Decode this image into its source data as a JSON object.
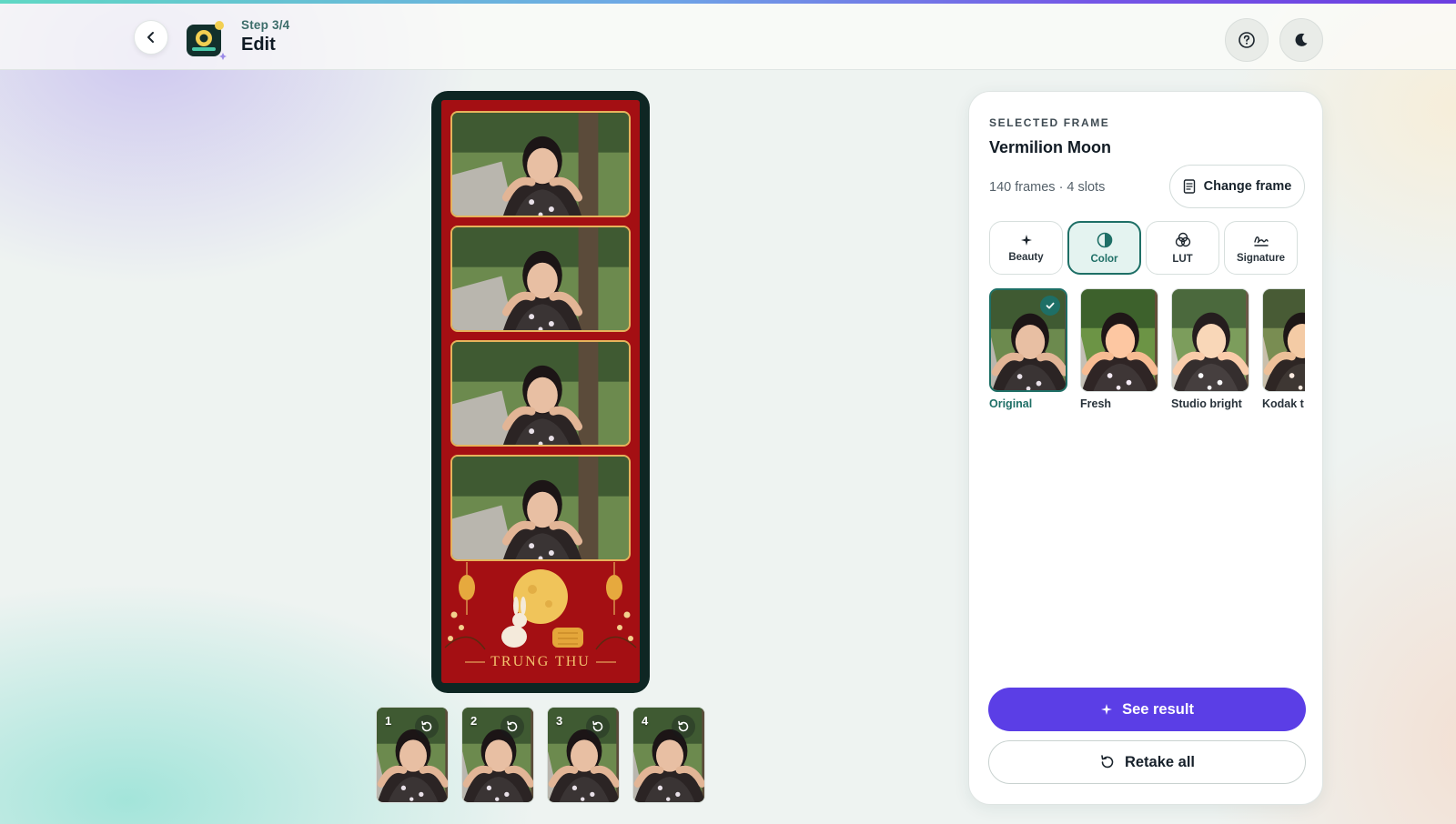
{
  "header": {
    "step_label": "Step 3/4",
    "title": "Edit",
    "back_icon": "chevron-left-icon",
    "help_icon": "question-circle-icon",
    "theme_icon": "moon-icon"
  },
  "strip": {
    "caption": "TRUNG THU",
    "frame_color": "#a40f13",
    "slots": 4
  },
  "thumbnails": [
    {
      "number": "1"
    },
    {
      "number": "2"
    },
    {
      "number": "3"
    },
    {
      "number": "4"
    }
  ],
  "panel": {
    "section_label": "SELECTED FRAME",
    "frame_name": "Vermilion Moon",
    "frame_meta": "140 frames · 4 slots",
    "change_frame_label": "Change frame",
    "tools": [
      {
        "label": "Beauty",
        "icon": "sparkle-icon"
      },
      {
        "label": "Color",
        "icon": "contrast-icon",
        "active": true
      },
      {
        "label": "LUT",
        "icon": "color-circles-icon"
      },
      {
        "label": "Signature",
        "icon": "signature-icon"
      }
    ],
    "filters": [
      {
        "name": "Original",
        "selected": true
      },
      {
        "name": "Fresh"
      },
      {
        "name": "Studio bright"
      },
      {
        "name": "Kodak t"
      }
    ],
    "see_result_label": "See result",
    "retake_label": "Retake all"
  },
  "colors": {
    "accent_teal": "#1e6f66",
    "primary_purple": "#5b3ee6"
  }
}
